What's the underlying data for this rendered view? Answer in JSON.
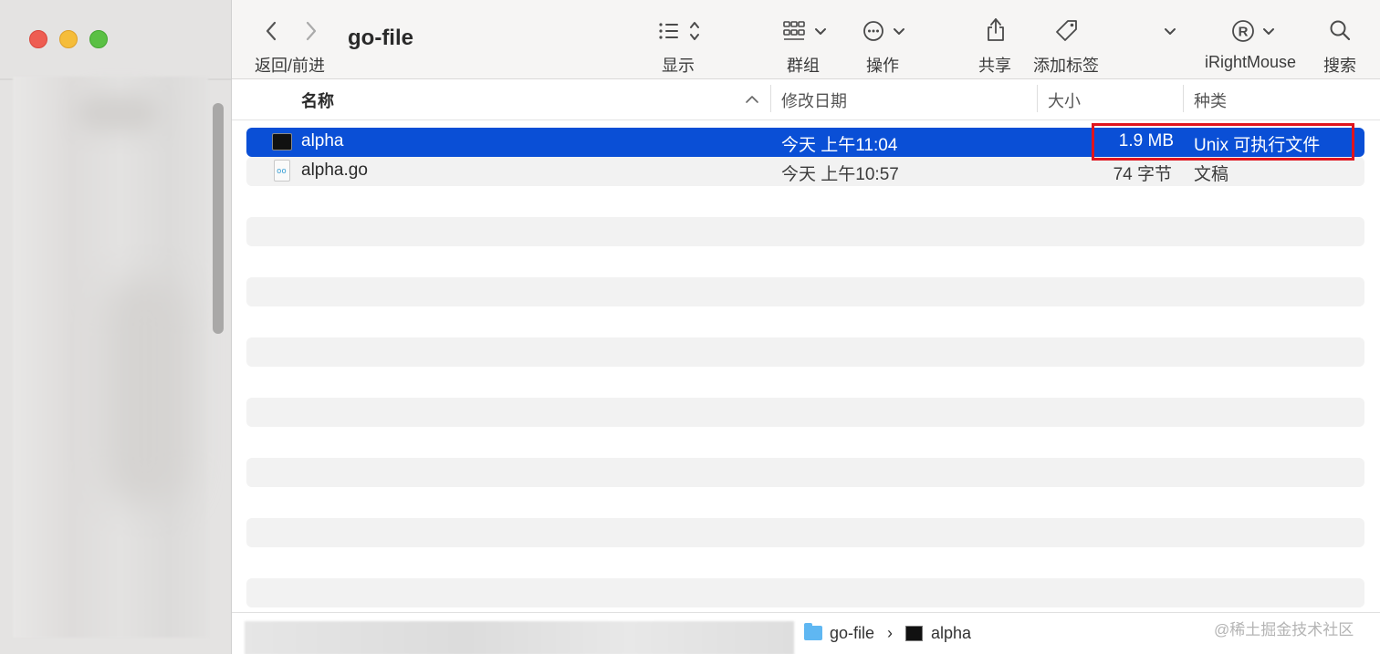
{
  "window": {
    "title": "go-file"
  },
  "toolbar": {
    "nav_label": "返回/前进",
    "view_label": "显示",
    "group_label": "群组",
    "action_label": "操作",
    "share_label": "共享",
    "tag_label": "添加标签",
    "irightmouse_label": "iRightMouse",
    "search_label": "搜索"
  },
  "columns": {
    "name": "名称",
    "date": "修改日期",
    "size": "大小",
    "kind": "种类"
  },
  "files": [
    {
      "name": "alpha",
      "date": "今天 上午11:04",
      "size": "1.9 MB",
      "kind": "Unix 可执行文件",
      "icon": "terminal-executable-icon",
      "selected": true
    },
    {
      "name": "alpha.go",
      "date": "今天 上午10:57",
      "size": "74 字节",
      "kind": "文稿",
      "icon": "go-document-icon",
      "selected": false
    }
  ],
  "pathbar": {
    "folder": "go-file",
    "separator": "›",
    "file": "alpha"
  },
  "watermark": "@稀土掘金技术社区",
  "colors": {
    "selection": "#0a4fd6",
    "highlight_box": "#e0141d",
    "folder": "#5fb7f2"
  }
}
